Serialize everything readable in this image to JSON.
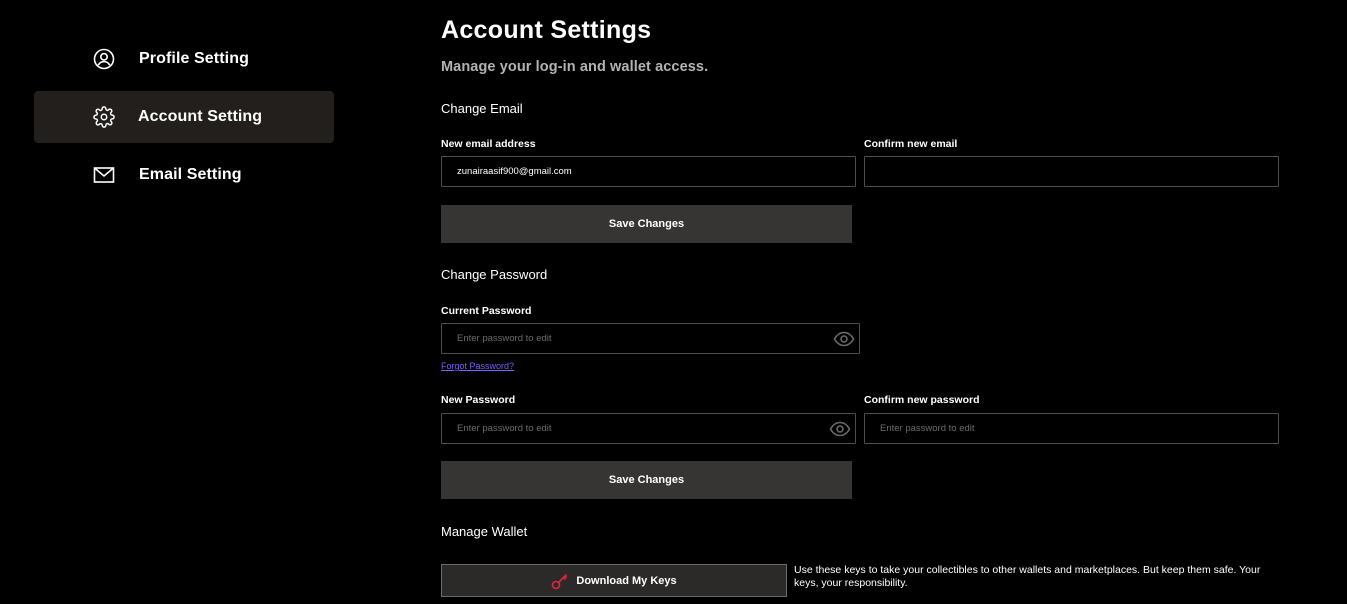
{
  "sidebar": {
    "items": [
      {
        "label": "Profile Setting",
        "icon": "user-circle-icon"
      },
      {
        "label": "Account Setting",
        "icon": "gear-icon",
        "active": true
      },
      {
        "label": "Email Setting",
        "icon": "envelope-icon"
      }
    ]
  },
  "header": {
    "title": "Account Settings",
    "subtitle": "Manage your log-in and wallet access."
  },
  "email_section": {
    "title": "Change Email",
    "new_email_label": "New email address",
    "new_email_value": "zunairaasif900@gmail.com",
    "confirm_email_label": "Confirm new email",
    "confirm_email_value": "",
    "save_label": "Save Changes"
  },
  "password_section": {
    "title": "Change Password",
    "current_label": "Current Password",
    "current_placeholder": "Enter password to edit",
    "forgot_link": "Forgot Password?",
    "new_label": "New Password",
    "new_placeholder": "Enter password to edit",
    "confirm_label": "Confirm new password",
    "confirm_placeholder": "Enter password to edit",
    "save_label": "Save Changes"
  },
  "wallet_section": {
    "title": "Manage Wallet",
    "download_label": "Download My Keys",
    "note": "Use these keys to take your collectibles to other wallets and marketplaces. But keep them safe. Your keys, your responsibility.",
    "key_icon_color": "#e0243c"
  },
  "colors": {
    "background": "#000000",
    "active_nav_bg": "#221f1c",
    "button_bg": "#373533",
    "link": "#7c5cff"
  }
}
